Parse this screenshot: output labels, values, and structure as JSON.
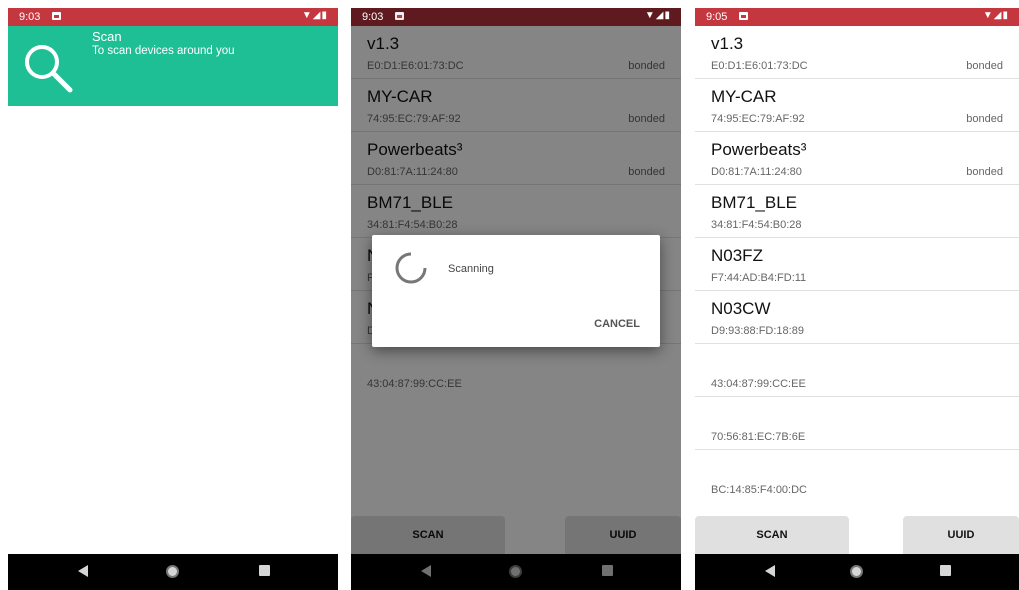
{
  "panels": {
    "p1": {
      "time": "9:03",
      "scan_title": "Scan",
      "scan_subtitle": "To scan devices around you"
    },
    "p2": {
      "time": "9:03",
      "dialog_text": "Scanning",
      "dialog_cancel": "CANCEL"
    },
    "p3": {
      "time": "9:05"
    }
  },
  "devices": [
    {
      "name": "v1.3",
      "address": "E0:D1:E6:01:73:DC",
      "status": "bonded"
    },
    {
      "name": "MY-CAR",
      "address": "74:95:EC:79:AF:92",
      "status": "bonded"
    },
    {
      "name": "Powerbeats³",
      "address": "D0:81:7A:11:24:80",
      "status": "bonded"
    },
    {
      "name": "BM71_BLE",
      "address": "34:81:F4:54:B0:28",
      "status": ""
    },
    {
      "name": "N03FZ",
      "address": "F7:44:AD:B4:FD:11",
      "status": ""
    },
    {
      "name": "N03CW",
      "address": "D9:93:88:FD:18:89",
      "status": ""
    },
    {
      "name": "",
      "address": "43:04:87:99:CC:EE",
      "status": ""
    },
    {
      "name": "",
      "address": "70:56:81:EC:7B:6E",
      "status": ""
    },
    {
      "name": "",
      "address": "BC:14:85:F4:00:DC",
      "status": ""
    }
  ],
  "buttons": {
    "scan": "SCAN",
    "uuid": "UUID"
  },
  "colors": {
    "status_bar": "#c5373f",
    "scan_card": "#1fbf96",
    "nav_bar": "#000000"
  },
  "icons": {
    "scan": "search-icon",
    "status_gallery": "image-icon",
    "status_wifi": "wifi-icon",
    "status_signal": "signal-icon",
    "status_battery": "battery-icon",
    "nav_back": "back-icon",
    "nav_home": "home-icon",
    "nav_recent": "recents-icon"
  }
}
